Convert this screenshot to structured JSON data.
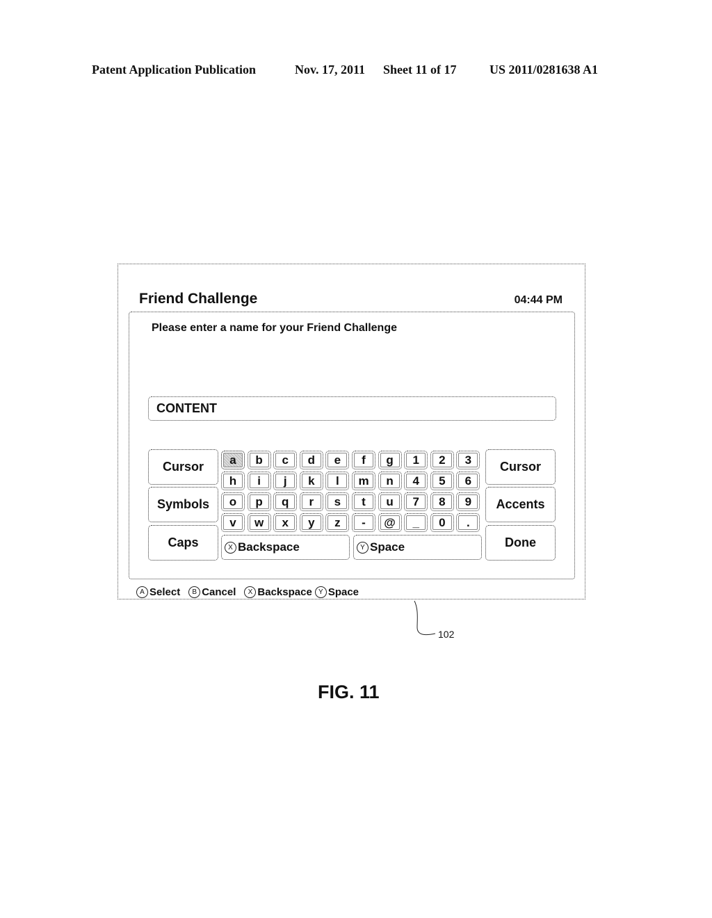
{
  "patent_header": {
    "publication": "Patent Application Publication",
    "date": "Nov. 17, 2011",
    "sheet": "Sheet 11 of 17",
    "number": "US 2011/0281638 A1"
  },
  "screen": {
    "title": "Friend Challenge",
    "clock": "04:44 PM",
    "prompt": "Please enter a name for your Friend Challenge",
    "input_value": "CONTENT",
    "left_buttons": [
      "Cursor",
      "Symbols",
      "Caps"
    ],
    "right_buttons": [
      "Cursor",
      "Accents",
      "Done"
    ],
    "keys": [
      [
        "a",
        "b",
        "c",
        "d",
        "e",
        "f",
        "g",
        "1",
        "2",
        "3"
      ],
      [
        "h",
        "i",
        "j",
        "k",
        "l",
        "m",
        "n",
        "4",
        "5",
        "6"
      ],
      [
        "o",
        "p",
        "q",
        "r",
        "s",
        "t",
        "u",
        "7",
        "8",
        "9"
      ],
      [
        "v",
        "w",
        "x",
        "y",
        "z",
        "-",
        "@",
        "_",
        "0",
        "."
      ]
    ],
    "selected_key": "a",
    "backspace_button": {
      "badge": "X",
      "label": "Backspace"
    },
    "space_button": {
      "badge": "Y",
      "label": "Space"
    },
    "footer_hints": [
      {
        "badge": "A",
        "label": "Select"
      },
      {
        "badge": "B",
        "label": "Cancel"
      },
      {
        "badge": "X",
        "label": "Backspace"
      },
      {
        "badge": "Y",
        "label": "Space"
      }
    ]
  },
  "reference_numeral": "102",
  "figure_label": "FIG. 11"
}
